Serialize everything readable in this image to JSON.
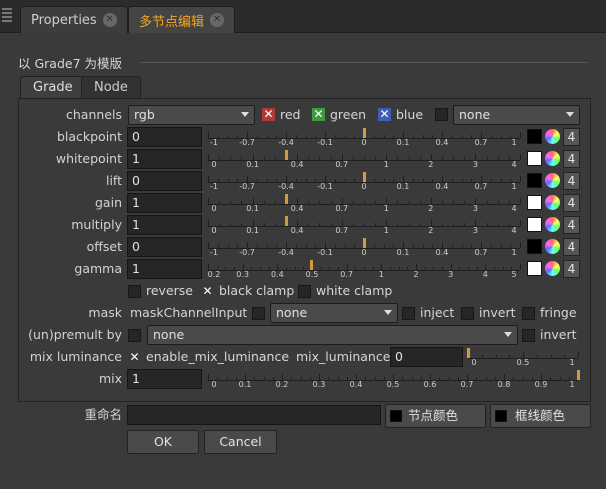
{
  "tabs": [
    {
      "label": "Properties",
      "active": false
    },
    {
      "label": "多节点编辑",
      "active": true
    }
  ],
  "panel_title": "以 Grade7 为模版",
  "subtabs": [
    "Grade",
    "Node"
  ],
  "channels": {
    "label": "channels",
    "value": "rgb",
    "red": "red",
    "green": "green",
    "blue": "blue",
    "extra": "none"
  },
  "params": [
    {
      "label": "blackpoint",
      "value": "0",
      "scale": "sym",
      "handle": 0.5,
      "swatch": "#000000",
      "count": "4"
    },
    {
      "label": "whitepoint",
      "value": "1",
      "scale": "pos",
      "handle": 0.25,
      "swatch": "#ffffff",
      "count": "4"
    },
    {
      "label": "lift",
      "value": "0",
      "scale": "sym",
      "handle": 0.5,
      "swatch": "#000000",
      "count": "4"
    },
    {
      "label": "gain",
      "value": "1",
      "scale": "pos",
      "handle": 0.25,
      "swatch": "#ffffff",
      "count": "4"
    },
    {
      "label": "multiply",
      "value": "1",
      "scale": "pos",
      "handle": 0.25,
      "swatch": "#ffffff",
      "count": "4"
    },
    {
      "label": "offset",
      "value": "0",
      "scale": "sym",
      "handle": 0.5,
      "swatch": "#000000",
      "count": "4"
    },
    {
      "label": "gamma",
      "value": "1",
      "scale": "gamma",
      "handle": 0.33,
      "swatch": "#ffffff",
      "count": "4"
    }
  ],
  "scales": {
    "sym": [
      "-1",
      "-0.7",
      "-0.4",
      "-0.1",
      "0",
      "0.1",
      "0.4",
      "0.7",
      "1"
    ],
    "pos": [
      "0",
      "0.1",
      "0.4",
      "0.7",
      "1",
      "2",
      "3",
      "4"
    ],
    "gamma": [
      "0.2",
      "0.3",
      "0.4",
      "0.5",
      "0.7",
      "1",
      "2",
      "3",
      "4",
      "5"
    ],
    "mix": [
      "0",
      "0.1",
      "0.2",
      "0.3",
      "0.4",
      "0.5",
      "0.6",
      "0.7",
      "0.8",
      "0.9",
      "1"
    ],
    "mixlum": [
      "0",
      "0.5",
      "1"
    ]
  },
  "options": {
    "reverse": "reverse",
    "black_clamp": "black clamp",
    "white_clamp": "white clamp"
  },
  "mask": {
    "label": "mask",
    "channel_input": "maskChannelInput",
    "value": "none",
    "inject": "inject",
    "invert": "invert",
    "fringe": "fringe"
  },
  "premult": {
    "label": "(un)premult by",
    "value": "none",
    "invert": "invert"
  },
  "mix_luminance": {
    "label": "mix luminance",
    "enable": "enable_mix_luminance",
    "field_label": "mix_luminance",
    "value": "0"
  },
  "mix": {
    "label": "mix",
    "value": "1"
  },
  "rename": {
    "label": "重命名",
    "node_color": "节点颜色",
    "border_color": "框线颜色"
  },
  "buttons": {
    "ok": "OK",
    "cancel": "Cancel"
  },
  "colors": {
    "accent": "#f5a623",
    "handle": "#d39b3c"
  }
}
